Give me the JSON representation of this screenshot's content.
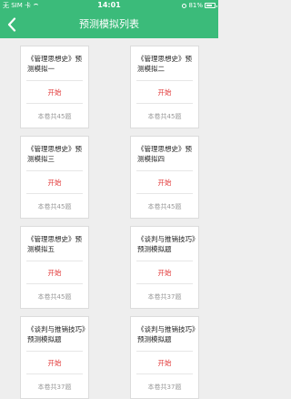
{
  "status_bar": {
    "carrier": "无 SIM 卡",
    "time": "14:01",
    "battery": "81%",
    "battery_level": 0.81
  },
  "nav": {
    "title": "预测模拟列表",
    "back_icon": "chevron-left-icon"
  },
  "colors": {
    "primary": "#3bbb7a",
    "start": "#e23a3a",
    "muted": "#999999"
  },
  "cards": [
    {
      "title": "《管理思想史》预测模拟一",
      "start": "开始",
      "count": "本卷共45题"
    },
    {
      "title": "《管理思想史》预测模拟二",
      "start": "开始",
      "count": "本卷共45题"
    },
    {
      "title": "《管理思想史》预测模拟三",
      "start": "开始",
      "count": "本卷共45题"
    },
    {
      "title": "《管理思想史》预测模拟四",
      "start": "开始",
      "count": "本卷共45题"
    },
    {
      "title": "《管理思想史》预测模拟五",
      "start": "开始",
      "count": "本卷共45题"
    },
    {
      "title": "《谈判与推销技巧》预测模拟题",
      "start": "开始",
      "count": "本卷共37题"
    },
    {
      "title": "《谈判与推销技巧》预测模拟题",
      "start": "开始",
      "count": "本卷共37题"
    },
    {
      "title": "《谈判与推销技巧》预测模拟题",
      "start": "开始",
      "count": "本卷共37题"
    }
  ]
}
